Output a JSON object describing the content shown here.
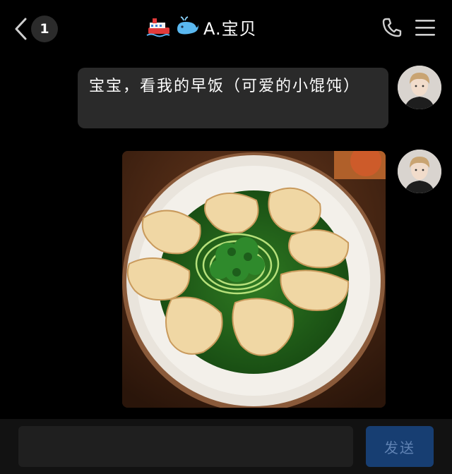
{
  "header": {
    "unread_count": "1",
    "title": "A.宝贝",
    "icons": {
      "back": "chevron-left-icon",
      "call": "phone-icon",
      "menu": "hamburger-menu-icon",
      "ship": "cruise-ship-emoji",
      "whale": "whale-emoji"
    }
  },
  "messages": [
    {
      "type": "text",
      "text": "宝宝，看我的早饭（可爱的小馄饨）"
    },
    {
      "type": "image",
      "subject": "wonton-plate-photo"
    }
  ],
  "input": {
    "placeholder": "",
    "send_label": "发送"
  },
  "colors": {
    "background": "#000000",
    "bubble": "#2a2a2a",
    "send_button": "#173e72",
    "send_text": "#5f82b3"
  }
}
